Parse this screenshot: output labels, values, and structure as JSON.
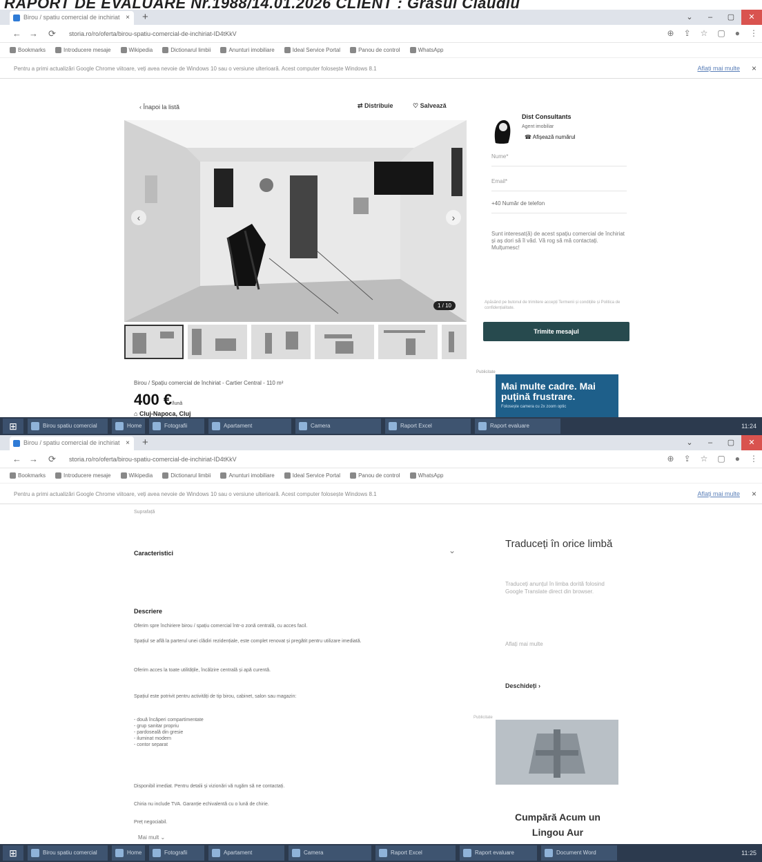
{
  "document_header": "RAPORT DE EVALUARE Nr.1988/14.01.2026 CLIENT : Grasul Claudiu",
  "browser": {
    "tab_title": "Birou / spatiu comercial de inchiriat",
    "new_tab": "+",
    "url": "storia.ro/ro/oferta/birou-spatiu-comercial-de-inchiriat-ID4tKkV",
    "bookmarks": [
      "Bookmarks",
      "Introducere mesaje",
      "Wikipedia",
      "Dictionarul limbii",
      "Anunturi imobiliare",
      "Ideal Service Portal",
      "Panou de control",
      "WhatsApp"
    ],
    "infobar_text": "Pentru a primi actualizări Google Chrome viitoare, veți avea nevoie de Windows 10 sau o versiune ulterioară. Acest computer folosește Windows 8.1",
    "infobar_more": "Aflați mai multe",
    "close": "×",
    "window_controls": [
      "⌄",
      "–",
      "▢",
      "✕"
    ]
  },
  "listing": {
    "back": "Înapoi la listă",
    "share": "Distribuie",
    "save": "Salvează",
    "photo_counter": "1 / 10",
    "breadcrumb": "Birou / Spațiu comercial de închiriat - Cartier Central - 110 m²",
    "price": "400 €",
    "price_suffix": "/lună",
    "location": "Cluj-Napoca, Cluj"
  },
  "agent": {
    "name": "Dist Consultants",
    "subtitle": "Agent imobiliar",
    "phone": "Afișează numărul"
  },
  "contact_form": {
    "name_label": "Nume*",
    "email_label": "Email*",
    "phone_label": "+40   Număr de telefon",
    "message": "Sunt interesat(ă) de acest spațiu comercial de închiriat și aș dori să îl văd. Vă rog să mă contactați. Mulțumesc!",
    "terms": "Apăsând pe butonul de trimitere accepți Termenii și condițiile și Politica de confidențialitate.",
    "send": "Trimite mesajul"
  },
  "ad1": {
    "label": "Publicitate",
    "headline": "Mai multe cadre. Mai puțină frustrare.",
    "sub": "Folosește camera cu 2x zoom optic"
  },
  "taskbar1": {
    "start": "⊞",
    "tasks": [
      "Birou spatiu comercial",
      "Home",
      "Fotografii",
      "Apartament",
      "Camera",
      "Raport Excel",
      "Raport evaluare"
    ],
    "clock": "11:24"
  },
  "taskbar2": {
    "start": "⊞",
    "tasks": [
      "Birou spatiu comercial",
      "Home",
      "Fotografii",
      "Apartament",
      "Camera",
      "Raport Excel",
      "Raport evaluare",
      "Document Word"
    ],
    "clock": "11:25"
  },
  "second_page": {
    "top_label": "Suprafață",
    "characteristics": "Caracteristici",
    "description_title": "Descriere",
    "description_paragraphs": [
      "Oferim spre închiriere birou / spațiu comercial într-o zonă centrală, cu acces facil.",
      "Spațiul se află la parterul unei clădiri rezidențiale, este complet renovat și pregătit pentru utilizare imediată.",
      "Oferim acces la toate utilitățile, încălzire centrală și apă curentă.",
      "Spațiul este potrivit pentru activități de tip birou, cabinet, salon sau magazin:",
      "- două încăperi compartimentate\n- grup sanitar propriu\n- pardoseală din gresie\n- iluminat modern\n- contor separat",
      "Disponibil imediat. Pentru detalii și vizionări vă rugăm să ne contactați.",
      "Chiria nu include TVA. Garanție echivalentă cu o lună de chirie.",
      "Preț negociabil."
    ],
    "read_more": "Mai mult"
  },
  "translate_panel": {
    "title": "Traduceți în orice limbă",
    "body": "Traduceți anunțul în limba dorită folosind Google Translate direct din browser.",
    "link": "Aflați mai multe",
    "open": "Deschideți"
  },
  "ad2": {
    "label": "Publicitate",
    "title": "Cumpără Acum un Lingou Aur"
  }
}
